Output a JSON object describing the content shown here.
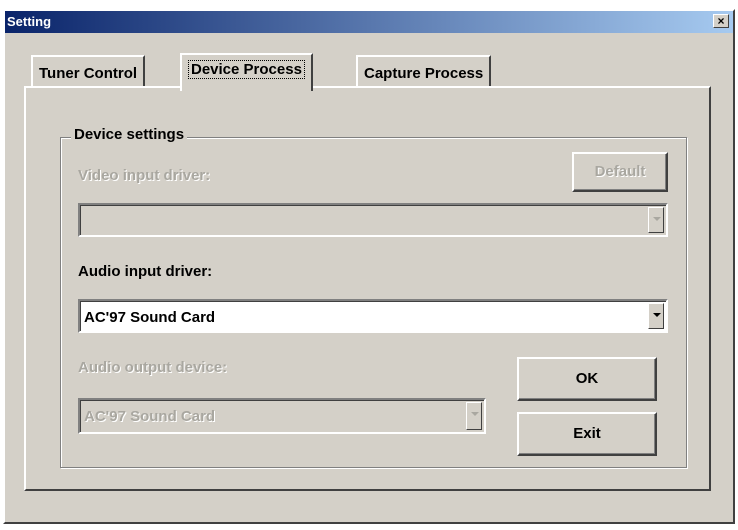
{
  "window": {
    "title": "Setting",
    "close_glyph": "×"
  },
  "tabs": [
    {
      "label": "Tuner Control",
      "active": false
    },
    {
      "label": "Device Process",
      "active": true
    },
    {
      "label": "Capture Process",
      "active": false
    }
  ],
  "device_settings": {
    "legend": "Device settings",
    "video_input": {
      "label": "Video input driver:",
      "value": "",
      "enabled": false
    },
    "default_button": {
      "label": "Default",
      "enabled": false
    },
    "audio_input": {
      "label": "Audio input driver:",
      "value": "AC'97 Sound Card",
      "enabled": true
    },
    "audio_output": {
      "label": "Audio output device:",
      "value": "AC'97 Sound Card",
      "enabled": false
    }
  },
  "buttons": {
    "ok": "OK",
    "exit": "Exit"
  },
  "icons": {
    "close": "close-icon",
    "dropdown": "chevron-down-icon"
  },
  "colors": {
    "titlebar_start": "#0a246a",
    "titlebar_end": "#a6caf0",
    "dialog_bg": "#d4d0c8",
    "disabled_text": "#a9a7a0"
  }
}
